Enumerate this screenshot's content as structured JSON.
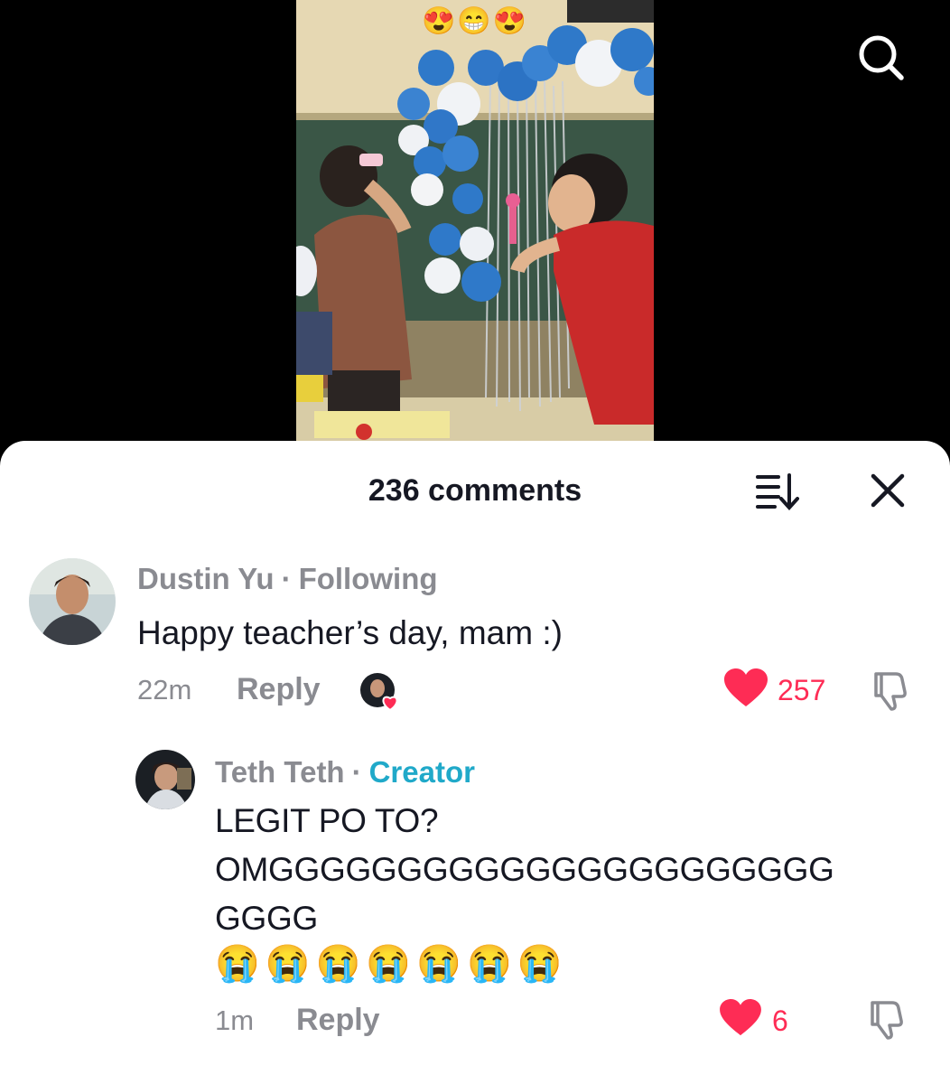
{
  "video": {
    "overlay_emoji": "😍😁😍",
    "search_icon": "search-icon"
  },
  "comments_panel": {
    "count_label": "236 comments",
    "sort_icon": "sort-icon",
    "close_icon": "close-icon"
  },
  "comments": [
    {
      "author": "Dustin Yu",
      "separator": "·",
      "tag": "Following",
      "text": "Happy teacher’s day, mam :)",
      "time": "22m",
      "reply_label": "Reply",
      "liked_by_creator": true,
      "likes": "257",
      "like_color": "#fe2c55"
    },
    {
      "author": "Teth Teth",
      "separator": "·",
      "tag": "Creator",
      "tag_color": "#20a9c9",
      "text": "LEGIT PO TO?\nOMGGGGGGGGGGGGGGGGGGGGGG\nGGGG",
      "emoji_line": "😭😭😭😭😭😭😭",
      "time": "1m",
      "reply_label": "Reply",
      "likes": "6",
      "like_color": "#fe2c55"
    }
  ]
}
